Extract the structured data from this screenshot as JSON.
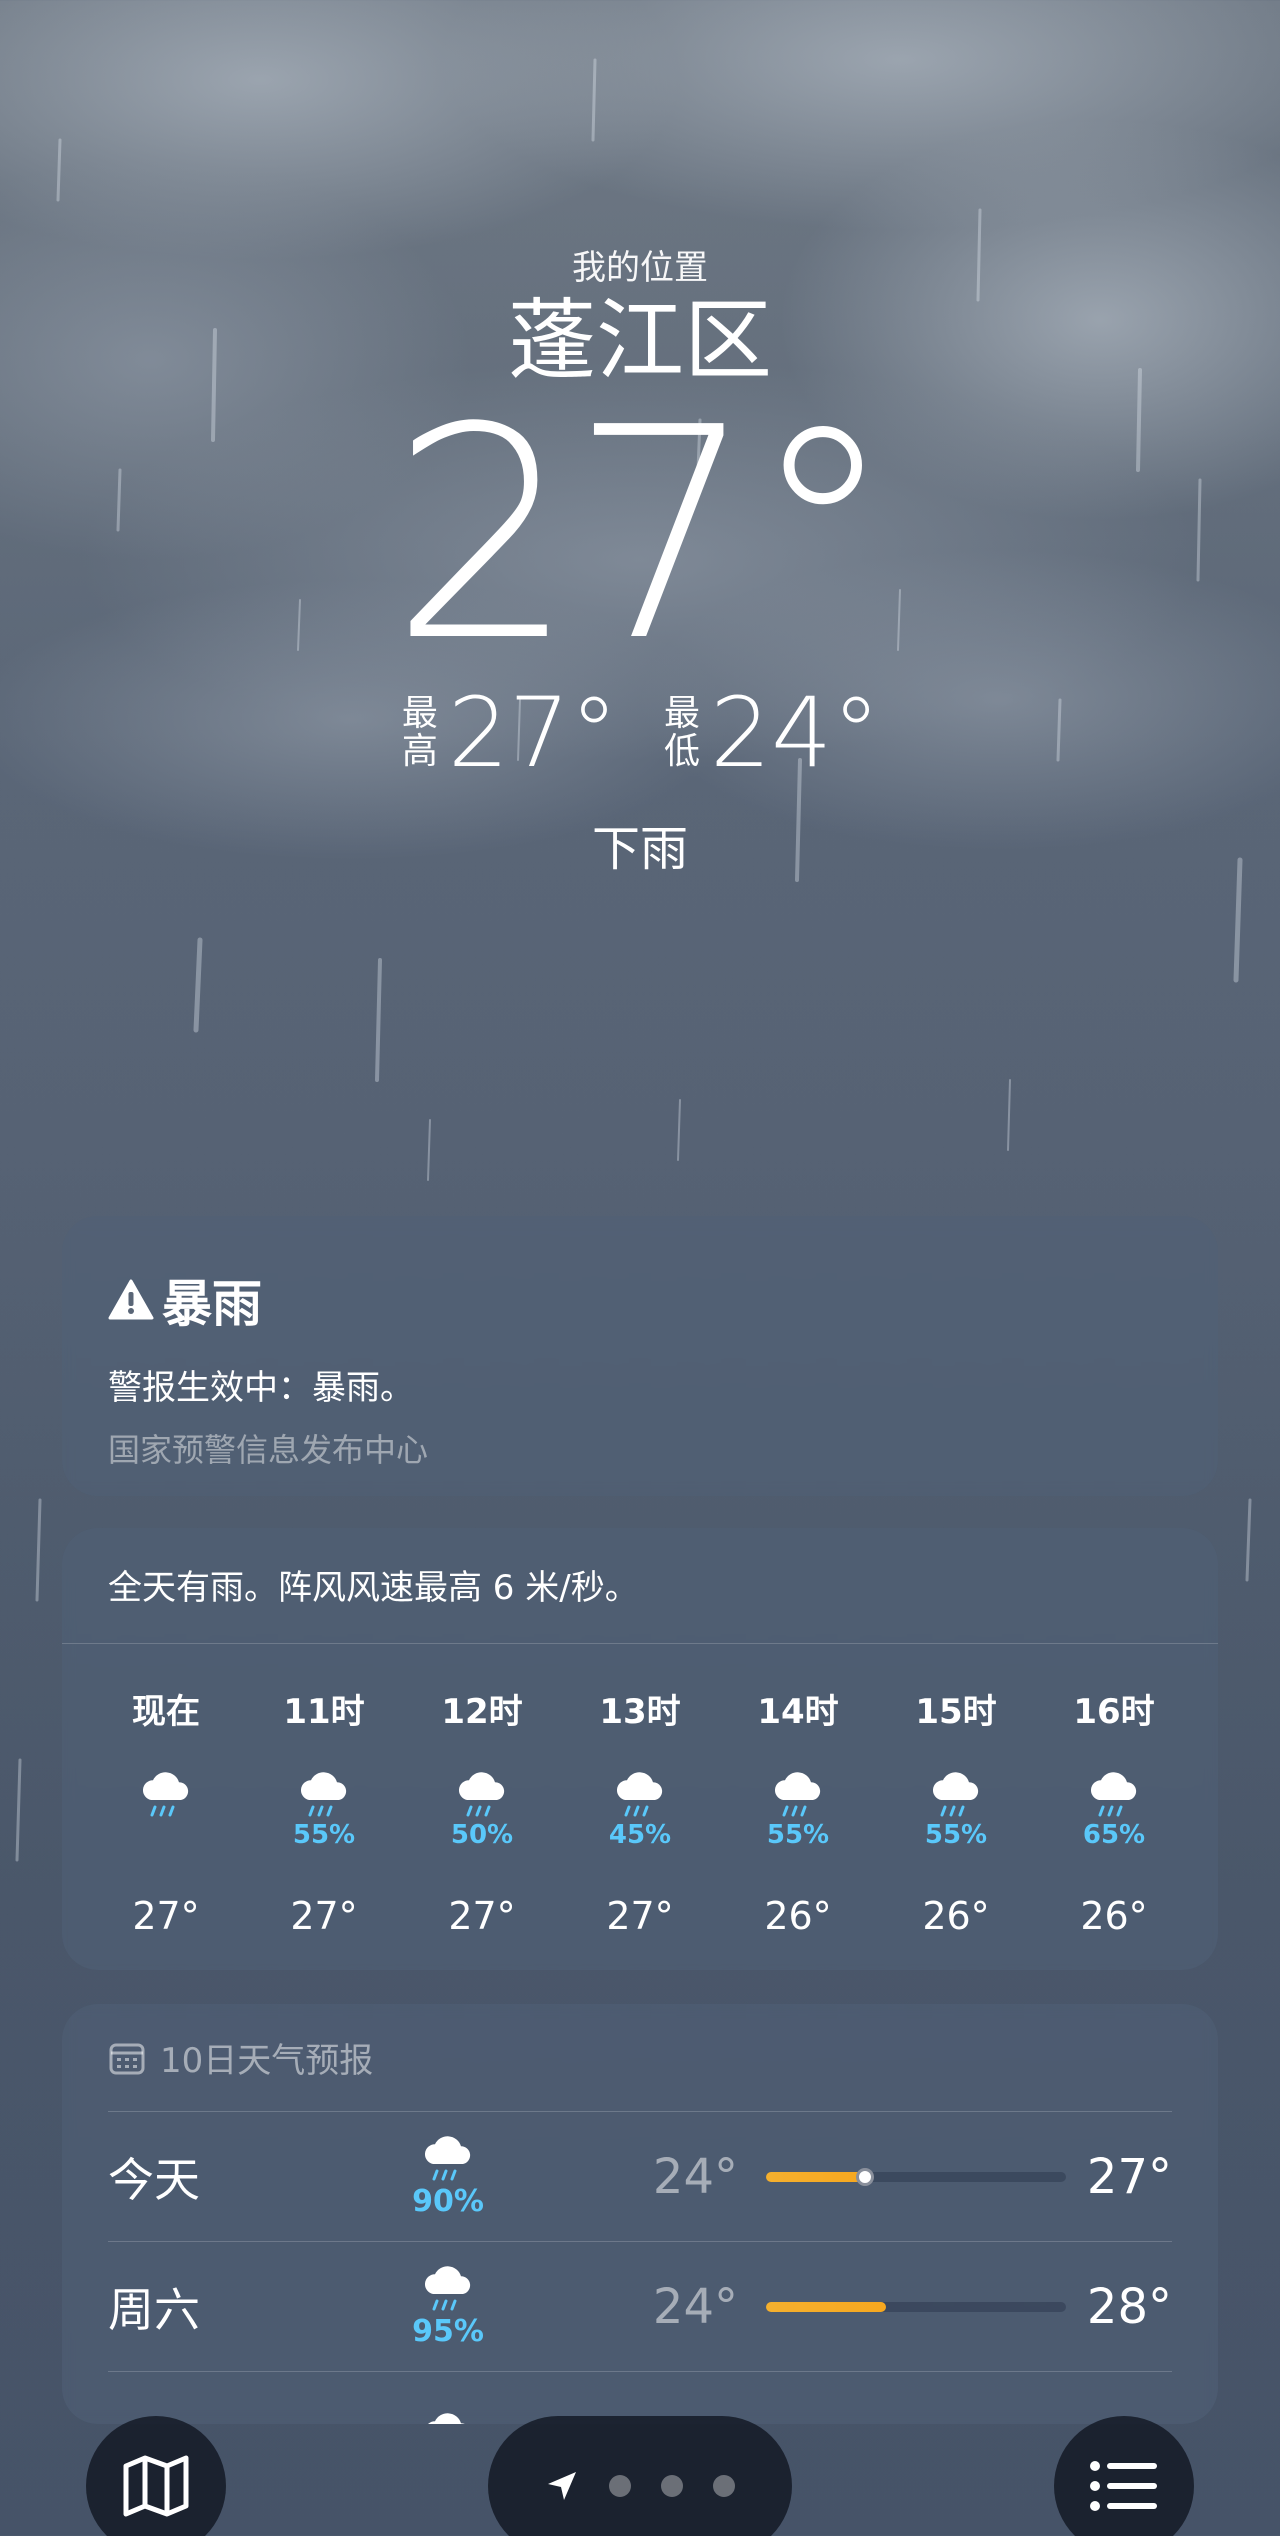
{
  "header": {
    "location_label": "我的位置",
    "location_name": "蓬江区",
    "current_temp": "27°",
    "high_label": "最高",
    "high": "27°",
    "low_label": "最低",
    "low": "24°",
    "condition": "下雨"
  },
  "alert": {
    "title": "暴雨",
    "text": "警报生效中：暴雨。",
    "source": "国家预警信息发布中心",
    "icon": "warning-triangle-icon"
  },
  "hourly": {
    "summary": "全天有雨。阵风风速最高 6 米/秒。",
    "hours": [
      {
        "time": "现在",
        "icon": "rain-cloud-icon",
        "precip": "",
        "temp": "27°"
      },
      {
        "time": "11时",
        "icon": "rain-cloud-icon",
        "precip": "55%",
        "temp": "27°"
      },
      {
        "time": "12时",
        "icon": "rain-cloud-icon",
        "precip": "50%",
        "temp": "27°"
      },
      {
        "time": "13时",
        "icon": "rain-cloud-icon",
        "precip": "45%",
        "temp": "27°"
      },
      {
        "time": "14时",
        "icon": "rain-cloud-icon",
        "precip": "55%",
        "temp": "26°"
      },
      {
        "time": "15时",
        "icon": "rain-cloud-icon",
        "precip": "55%",
        "temp": "26°"
      },
      {
        "time": "16时",
        "icon": "rain-cloud-icon",
        "precip": "65%",
        "temp": "26°"
      }
    ]
  },
  "forecast": {
    "title": "10日天气预报",
    "icon": "calendar-icon",
    "days": [
      {
        "name": "今天",
        "icon": "rain-cloud-icon",
        "precip": "90%",
        "low": "24°",
        "high": "27°",
        "range_start": 0.0,
        "range_end": 0.33,
        "current": 0.33
      },
      {
        "name": "周六",
        "icon": "rain-cloud-icon",
        "precip": "95%",
        "low": "24°",
        "high": "28°",
        "range_start": 0.0,
        "range_end": 0.4,
        "current": null
      }
    ]
  },
  "bottom_bar": {
    "map_icon": "map-icon",
    "location_arrow_icon": "location-arrow-icon",
    "page_count": 3,
    "list_icon": "list-icon"
  },
  "colors": {
    "precip": "#5ac8fa",
    "range_bar": "#f5b02e"
  }
}
